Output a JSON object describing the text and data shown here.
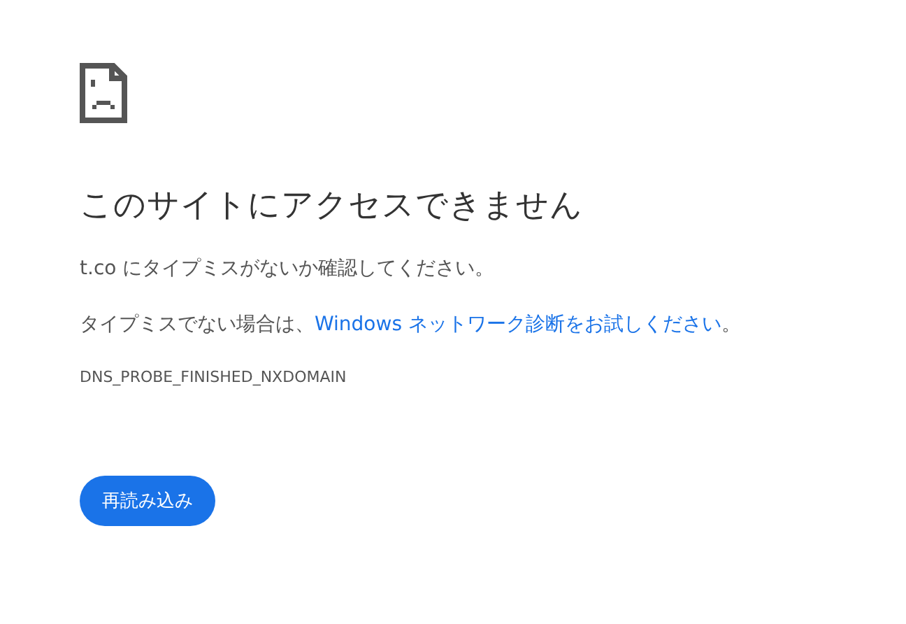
{
  "title": "このサイトにアクセスできません",
  "message": "t.co にタイプミスがないか確認してください。",
  "suggestion": {
    "prefix": "タイプミスでない場合は、",
    "link": "Windows ネットワーク診断をお試しください",
    "suffix": "。"
  },
  "error_code": "DNS_PROBE_FINISHED_NXDOMAIN",
  "buttons": [
    "再読み込み"
  ]
}
